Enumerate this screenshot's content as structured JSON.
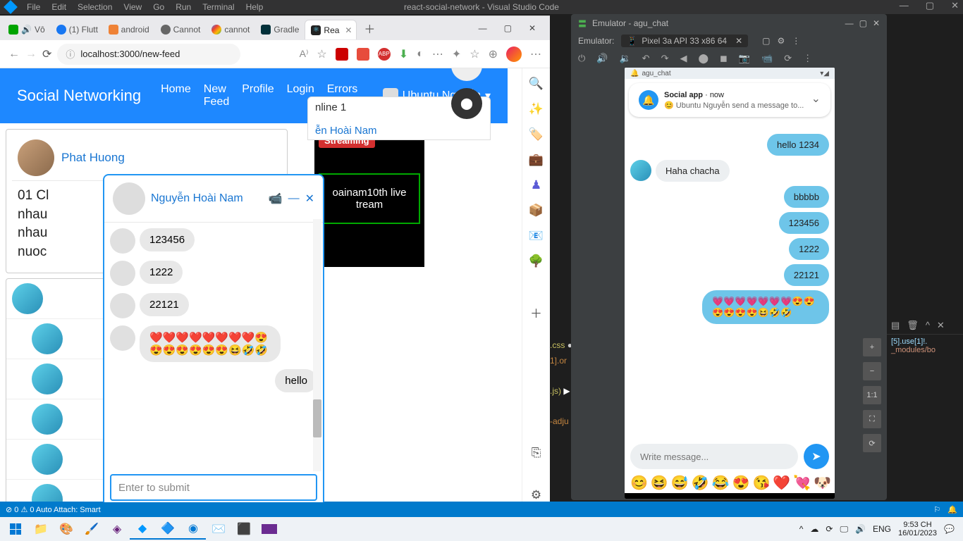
{
  "vscode": {
    "menu": [
      "File",
      "Edit",
      "Selection",
      "View",
      "Go",
      "Run",
      "Terminal",
      "Help"
    ],
    "title": "react-social-network - Visual Studio Code",
    "status_left": "⊘ 0 ⚠ 0   Auto Attach: Smart",
    "terminal_lines": [
      ".css",
      "1].or",
      "",
      ".js)",
      "",
      "-adju"
    ],
    "side_lines": [
      "[5].use[1]!.",
      "_modules/bo"
    ]
  },
  "edge": {
    "tabs": [
      {
        "icon": "#00a400",
        "label": "Vô"
      },
      {
        "icon": "#1877f2",
        "label": "(1) Flutt"
      },
      {
        "icon": "#ef8236",
        "label": "android"
      },
      {
        "icon": "#666",
        "label": "Cannot"
      },
      {
        "icon": "#4285f4",
        "label": "cannot"
      },
      {
        "icon": "#02303a",
        "label": "Gradle"
      },
      {
        "icon": "#61dafb",
        "label": "Rea",
        "active": true
      }
    ],
    "url": "localhost:3000/new-feed",
    "sidebar_icons": [
      "🔍",
      "✨",
      "🏷️",
      "💼",
      "♟",
      "📦",
      "📧",
      "🌳",
      "",
      "＋",
      "",
      "⎘",
      "",
      "⚙"
    ]
  },
  "social": {
    "brand": "Social Networking",
    "nav": [
      "Home",
      "New Feed",
      "Profile",
      "Login",
      "Errors"
    ],
    "user": "Ubuntu Nguyễn",
    "post": {
      "name": "Phat Huong",
      "body1": "01 Cl",
      "body2": "nhau",
      "body3": "nhau",
      "body4": "nuoc"
    },
    "stream": {
      "badge": "Streaming",
      "title": "oainam10th live tream"
    },
    "bottom_strip1": "nline 1",
    "bottom_strip2": "ễn Hoài Nam"
  },
  "chat_popup": {
    "name": "Nguyễn Hoài Nam",
    "msgs": [
      {
        "text": "123456"
      },
      {
        "text": "1222"
      },
      {
        "text": "22121"
      },
      {
        "text": "❤️❤️❤️❤️❤️❤️❤️❤️😍😍😍😍😍😍😍😆🤣🤣"
      },
      {
        "text": "hello",
        "right": true
      }
    ],
    "placeholder": "Enter to submit"
  },
  "emulator": {
    "win_title": "Emulator - agu_chat",
    "device_label": "Emulator:",
    "device_name": "Pixel 3a API 33 x86 64",
    "side_controls": [
      "+",
      "−",
      "1:1",
      "⛶",
      "⟳"
    ]
  },
  "phone": {
    "status_left": "agu_chat",
    "notif": {
      "title": "Social app",
      "time": "now",
      "sub": "😊 Ubuntu Nguyễn send a message to..."
    },
    "thread": [
      {
        "text": "hello 1234",
        "self": true
      },
      {
        "text": "Haha chacha",
        "self": false,
        "avatar": true
      },
      {
        "text": "bbbbb",
        "self": true
      },
      {
        "text": "123456",
        "self": true
      },
      {
        "text": "1222",
        "self": true
      },
      {
        "text": "22121",
        "self": true
      },
      {
        "text": "💗💗💗💗💗💗💗😍😍😍😍😍😍😆🤣🤣",
        "self": true
      }
    ],
    "input_placeholder": "Write message...",
    "emoji_row": [
      "😊",
      "😆",
      "😅",
      "🤣",
      "😂",
      "😍",
      "😘",
      "❤️",
      "💘",
      "🐶"
    ]
  },
  "taskbar": {
    "tray_lang": "ENG",
    "time": "9:53 CH",
    "date": "16/01/2023"
  }
}
